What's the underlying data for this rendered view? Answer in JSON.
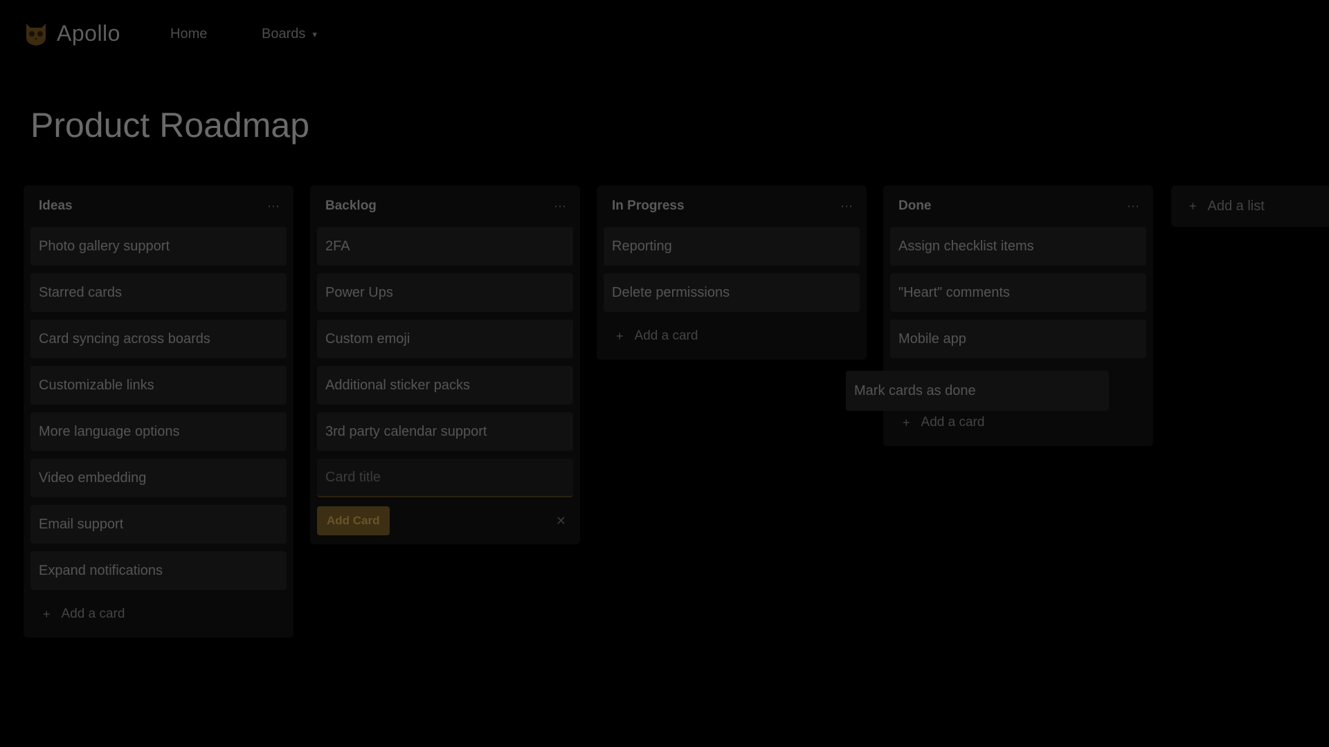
{
  "app": {
    "name": "Apollo",
    "logo_icon": "owl-logo-icon",
    "accent_color": "#c08a2c"
  },
  "nav": {
    "home_label": "Home",
    "boards_label": "Boards",
    "boards_icon": "chevron-down-icon"
  },
  "board": {
    "title": "Product Roadmap"
  },
  "lists": [
    {
      "title": "Ideas",
      "cards": [
        "Photo gallery support",
        "Starred cards",
        "Card syncing across boards",
        "Customizable links",
        "More language options",
        "Video embedding",
        "Email support",
        "Expand notifications"
      ],
      "add_card_label": "Add a card"
    },
    {
      "title": "Backlog",
      "cards": [
        "2FA",
        "Power Ups",
        "Custom emoji",
        "Additional sticker packs",
        "3rd party calendar support"
      ],
      "composer_placeholder": "Card title",
      "add_button_label": "Add Card"
    },
    {
      "title": "In Progress",
      "cards": [
        "Reporting",
        "Delete permissions"
      ],
      "add_card_label": "Add a card"
    },
    {
      "title": "Done",
      "cards": [
        "Assign checklist items",
        "\"Heart\" comments",
        "Mobile app"
      ],
      "add_card_label": "Add a card"
    }
  ],
  "dragging_card": "Mark cards as done",
  "add_list_label": "Add a list"
}
